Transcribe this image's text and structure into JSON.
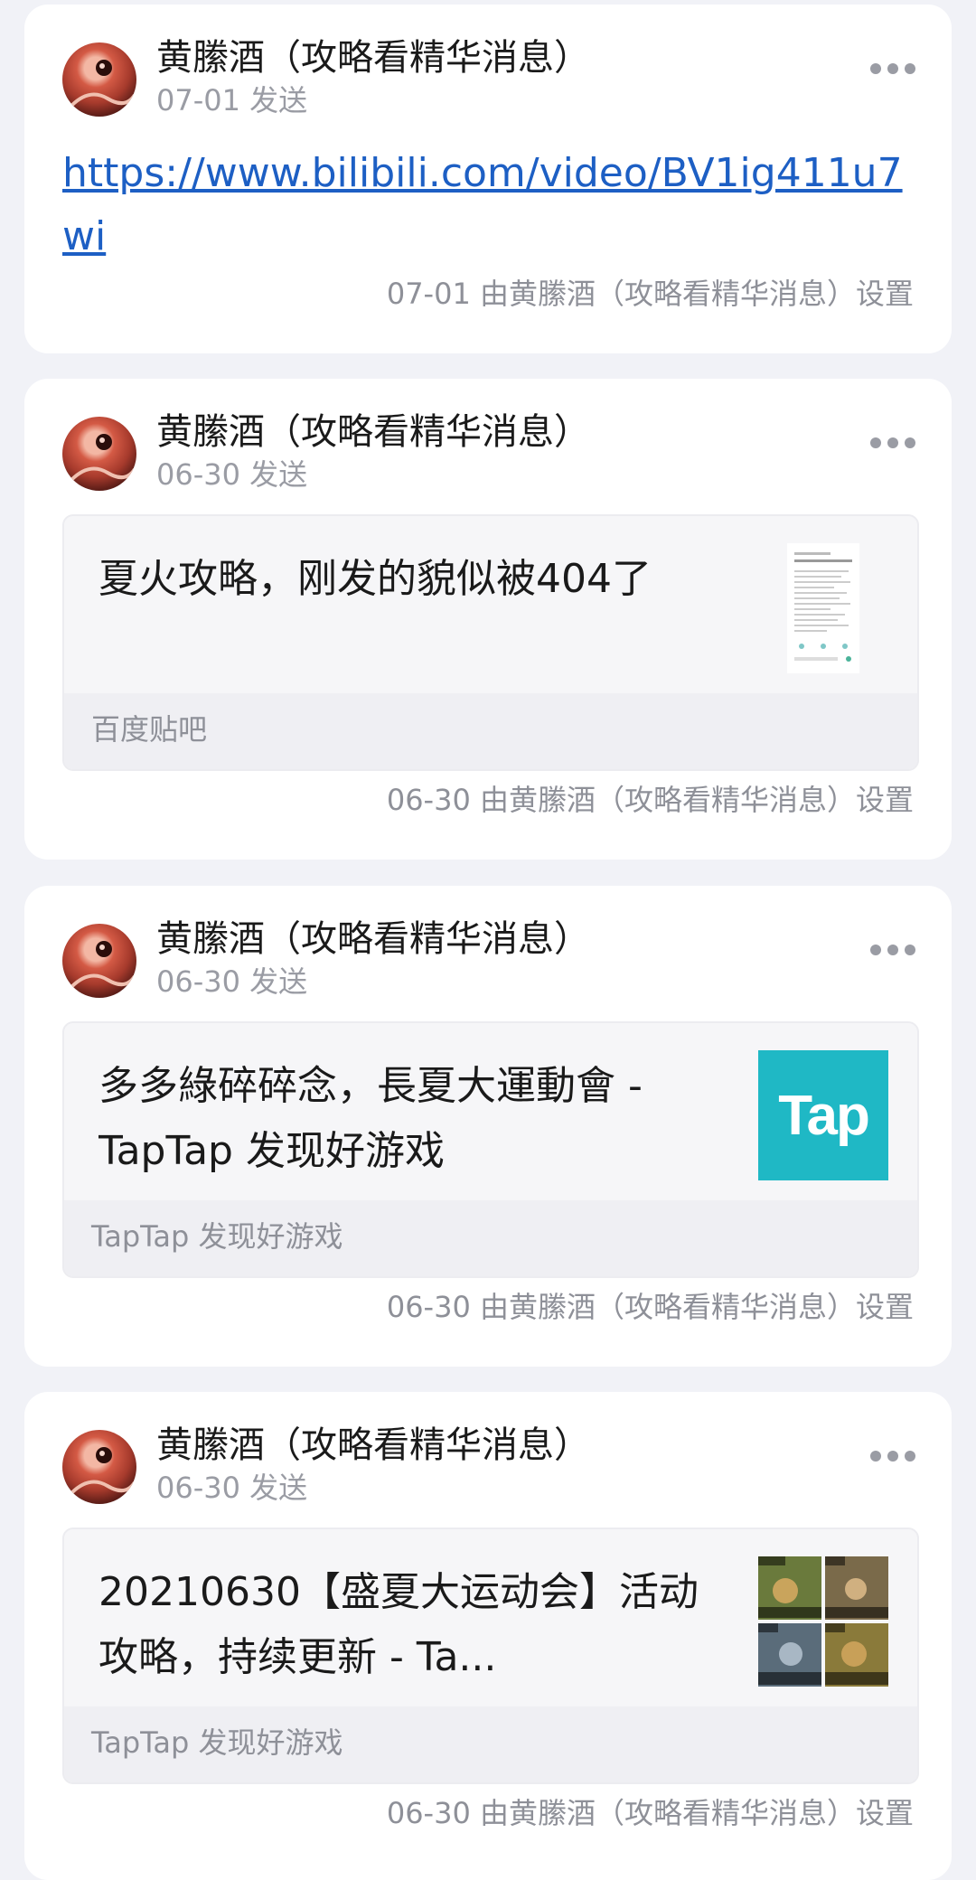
{
  "posts": [
    {
      "sender": "黄縢酒（攻略看精华消息）",
      "date": "07-01 发送",
      "link": "https://www.bilibili.com/video/BV1ig411u7wi",
      "footer": "07-01 由黄縢酒（攻略看精华消息）设置"
    },
    {
      "sender": "黄縢酒（攻略看精华消息）",
      "date": "06-30 发送",
      "share_title": "夏火攻略，刚发的貌似被404了",
      "share_source": "百度贴吧",
      "thumb_icon": "document-screenshot-thumbnail",
      "footer": "06-30 由黄縢酒（攻略看精华消息）设置"
    },
    {
      "sender": "黄縢酒（攻略看精华消息）",
      "date": "06-30 发送",
      "share_title": "多多綠碎碎念，長夏大運動會 - TapTap 发现好游戏",
      "share_source": "TapTap 发现好游戏",
      "thumb_logo": "Tap",
      "thumb_color": "#1fb8c5",
      "footer": "06-30 由黄縢酒（攻略看精华消息）设置"
    },
    {
      "sender": "黄縢酒（攻略看精华消息）",
      "date": "06-30 发送",
      "share_title": "20210630【盛夏大运动会】活动攻略，持续更新 - Ta...",
      "share_source": "TapTap 发现好游戏",
      "thumb_icon": "game-collage-thumbnail",
      "footer": "06-30 由黄縢酒（攻略看精华消息）设置"
    }
  ],
  "colors": {
    "background": "#f1f2f7",
    "card": "#ffffff",
    "link": "#1d5fc4",
    "muted": "#8e9098"
  }
}
